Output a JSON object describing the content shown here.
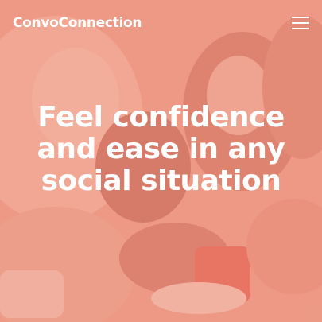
{
  "brand": {
    "name": "ConvoConnection"
  },
  "nav": {
    "menu_icon": "hamburger-menu-icon"
  },
  "hero": {
    "headline": "Feel confidence and ease in any social situation",
    "image_description_icon": "people-laughing-photo"
  },
  "colors": {
    "overlay": "#ee8c78",
    "text": "#ffffff"
  }
}
